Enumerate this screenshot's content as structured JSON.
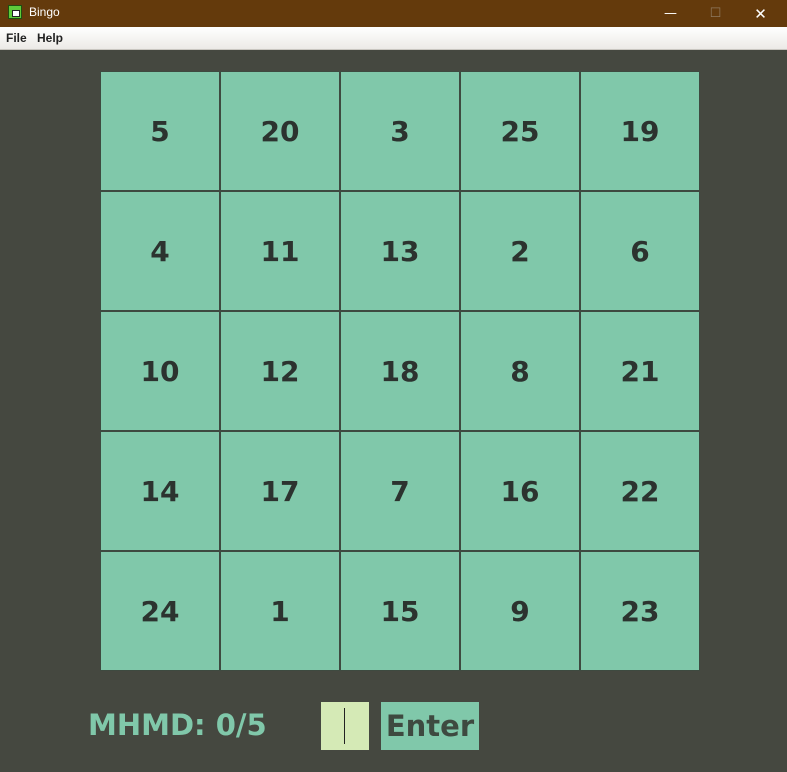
{
  "window": {
    "title": "Bingo",
    "controls": {
      "minimize_glyph": "—",
      "maximize_glyph": "☐",
      "close_glyph": "✕"
    }
  },
  "menu": {
    "file_label": "File",
    "help_label": "Help"
  },
  "board": {
    "cells": [
      "5",
      "20",
      "3",
      "25",
      "19",
      "4",
      "11",
      "13",
      "2",
      "6",
      "10",
      "12",
      "18",
      "8",
      "21",
      "14",
      "17",
      "7",
      "16",
      "22",
      "24",
      "1",
      "15",
      "9",
      "23"
    ]
  },
  "footer": {
    "score_text": "MHMD: 0/5",
    "input_value": "",
    "enter_label": "Enter"
  },
  "colors": {
    "background": "#454840",
    "titlebar": "#643a0c",
    "cell": "#80c8aa",
    "cell_text": "#2c332f",
    "input": "#d5eab6"
  }
}
